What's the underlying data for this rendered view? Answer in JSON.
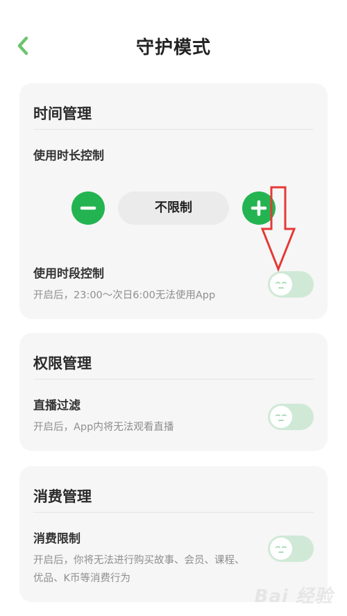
{
  "header": {
    "title": "守护模式",
    "back_icon": "chevron-left-icon",
    "accent_color": "#6cc46e"
  },
  "sections": {
    "time": {
      "title": "时间管理",
      "duration_label": "使用时长控制",
      "duration_value": "不限制",
      "decrease_icon": "minus-icon",
      "increase_icon": "plus-icon",
      "schedule_label": "使用时段控制",
      "schedule_desc": "开启后，23:00～次日6:00无法使用App",
      "schedule_enabled": false
    },
    "permission": {
      "title": "权限管理",
      "live_label": "直播过滤",
      "live_desc": "开启后，App内将无法观看直播",
      "live_enabled": false
    },
    "spending": {
      "title": "消费管理",
      "limit_label": "消费限制",
      "limit_desc_line1": "开启后，你将无法进行购买故事、会员、课程、",
      "limit_desc_line2": "优品、K币等消费行为",
      "limit_enabled": false
    }
  },
  "colors": {
    "primary_green": "#23b451",
    "toggle_off_track": "#cfe9d6",
    "card_background": "#f6f6f6",
    "annotation_red": "#e53935"
  },
  "watermark": {
    "text": "Bai 经验"
  }
}
